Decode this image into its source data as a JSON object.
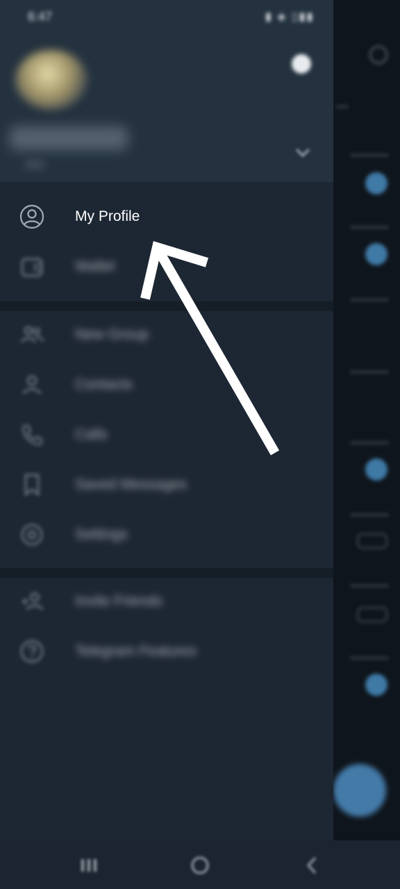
{
  "status_bar": {
    "time": "6:47"
  },
  "header": {
    "name": "",
    "phone": ""
  },
  "menu": {
    "items": [
      {
        "label": "My Profile",
        "icon": "person-circle-icon"
      },
      {
        "label": "Wallet",
        "icon": "wallet-icon"
      },
      {
        "label": "New Group",
        "icon": "group-icon"
      },
      {
        "label": "Contacts",
        "icon": "contact-icon"
      },
      {
        "label": "Calls",
        "icon": "phone-icon"
      },
      {
        "label": "Saved Messages",
        "icon": "bookmark-icon"
      },
      {
        "label": "Settings",
        "icon": "gear-icon"
      },
      {
        "label": "Invite Friends",
        "icon": "invite-icon"
      },
      {
        "label": "Telegram Features",
        "icon": "question-icon"
      }
    ]
  },
  "colors": {
    "drawer_bg": "#1d2733",
    "header_bg": "#24323f",
    "accent": "#4f9bd4",
    "arrow": "#ffffff"
  }
}
